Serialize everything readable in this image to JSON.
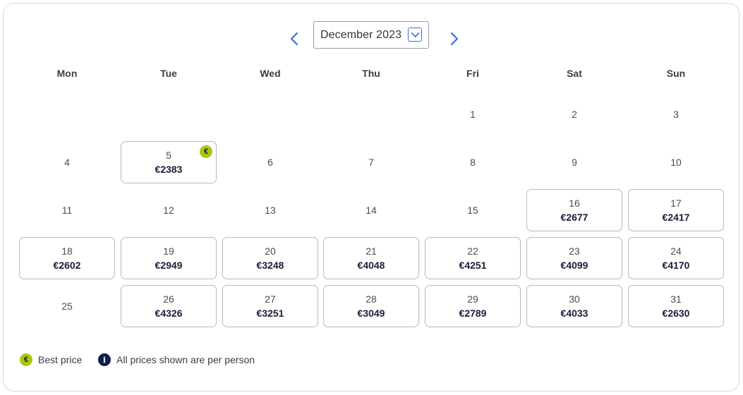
{
  "calendar": {
    "month_label": "December 2023",
    "nav": {
      "prev_icon": "chevron-left-icon",
      "next_icon": "chevron-right-icon"
    },
    "weekdays": [
      "Mon",
      "Tue",
      "Wed",
      "Thu",
      "Fri",
      "Sat",
      "Sun"
    ],
    "days": [
      {
        "day": "1",
        "price": ""
      },
      {
        "day": "2",
        "price": ""
      },
      {
        "day": "3",
        "price": ""
      },
      {
        "day": "4",
        "price": ""
      },
      {
        "day": "5",
        "price": "€2383",
        "best": true
      },
      {
        "day": "6",
        "price": ""
      },
      {
        "day": "7",
        "price": ""
      },
      {
        "day": "8",
        "price": ""
      },
      {
        "day": "9",
        "price": ""
      },
      {
        "day": "10",
        "price": ""
      },
      {
        "day": "11",
        "price": ""
      },
      {
        "day": "12",
        "price": ""
      },
      {
        "day": "13",
        "price": ""
      },
      {
        "day": "14",
        "price": ""
      },
      {
        "day": "15",
        "price": ""
      },
      {
        "day": "16",
        "price": "€2677"
      },
      {
        "day": "17",
        "price": "€2417"
      },
      {
        "day": "18",
        "price": "€2602"
      },
      {
        "day": "19",
        "price": "€2949"
      },
      {
        "day": "20",
        "price": "€3248"
      },
      {
        "day": "21",
        "price": "€4048"
      },
      {
        "day": "22",
        "price": "€4251"
      },
      {
        "day": "23",
        "price": "€4099"
      },
      {
        "day": "24",
        "price": "€4170"
      },
      {
        "day": "25",
        "price": ""
      },
      {
        "day": "26",
        "price": "€4326"
      },
      {
        "day": "27",
        "price": "€3251"
      },
      {
        "day": "28",
        "price": "€3049"
      },
      {
        "day": "29",
        "price": "€2789"
      },
      {
        "day": "30",
        "price": "€4033"
      },
      {
        "day": "31",
        "price": "€2630"
      }
    ]
  },
  "legend": {
    "best_symbol": "€",
    "best_label": "Best price",
    "info_symbol": "i",
    "info_label": "All prices shown are per person"
  },
  "colors": {
    "accent": "#3a6fd8",
    "best_badge": "#a8c814",
    "info_badge": "#0f1f4a",
    "border": "#b9b9c0"
  }
}
